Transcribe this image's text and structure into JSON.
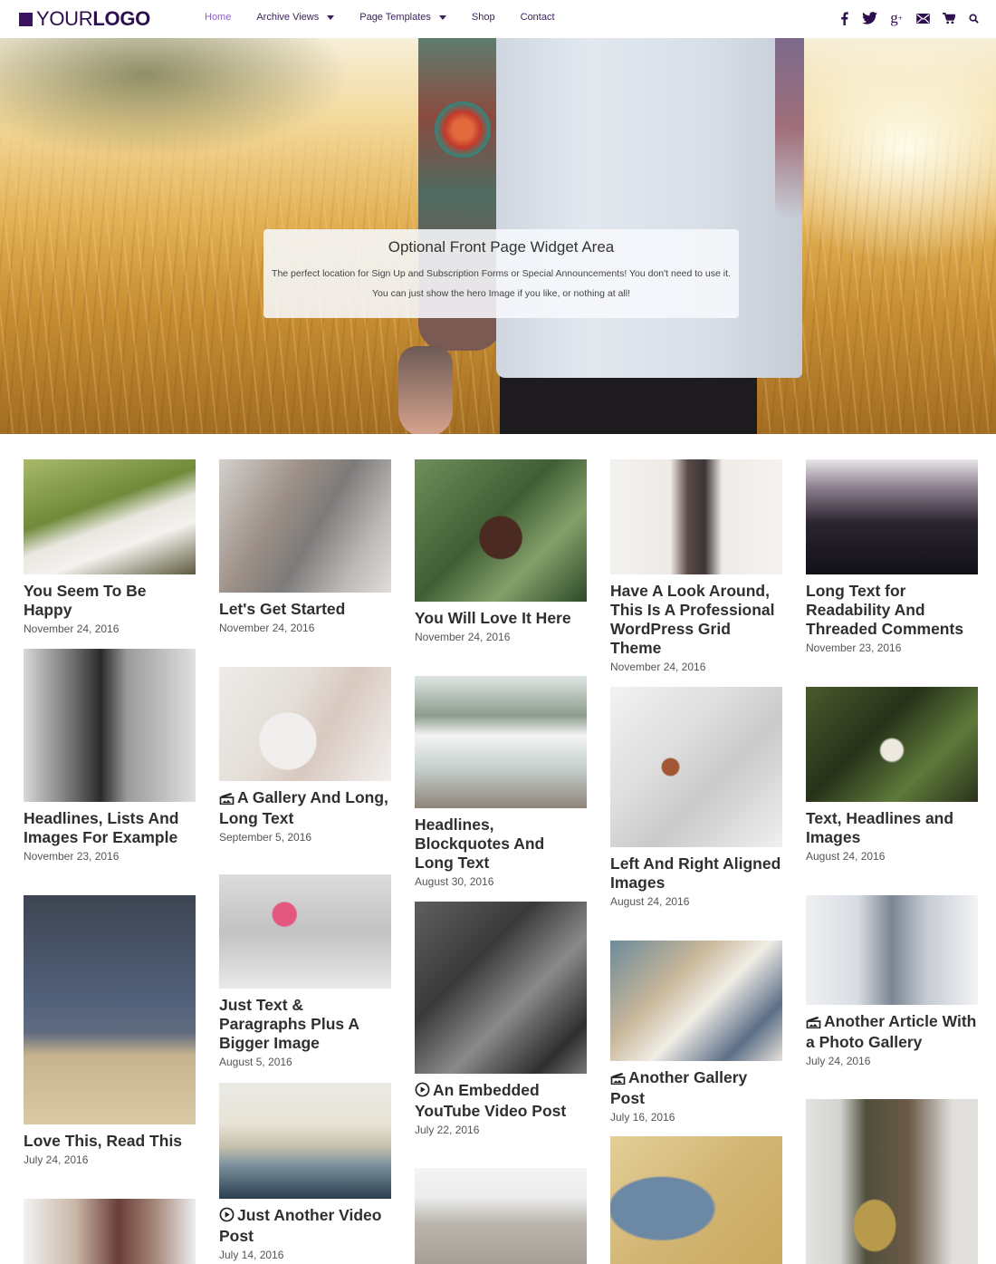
{
  "header": {
    "logo": {
      "light": "YOUR",
      "bold": "LOGO"
    },
    "nav": [
      {
        "label": "Home",
        "active": true,
        "dropdown": false
      },
      {
        "label": "Archive Views",
        "active": false,
        "dropdown": true
      },
      {
        "label": "Page Templates",
        "active": false,
        "dropdown": true
      },
      {
        "label": "Shop",
        "active": false,
        "dropdown": false
      },
      {
        "label": "Contact",
        "active": false,
        "dropdown": false
      }
    ],
    "social_icons": [
      "facebook-icon",
      "twitter-icon",
      "google-plus-icon",
      "email-icon",
      "cart-icon",
      "search-icon"
    ]
  },
  "hero": {
    "widget_title": "Optional Front Page Widget Area",
    "widget_text": "The perfect location for Sign Up and Subscription Forms or Special Announcements! You don't need to use it. You can just show the hero Image if you like, or nothing at all!"
  },
  "colors": {
    "brand": "#2d0f4f",
    "nav_active": "#8b5fc7",
    "text": "#2f2f2f"
  },
  "posts": [
    {
      "title": "You Seem To Be Happy",
      "date": "November 24, 2016",
      "format": ""
    },
    {
      "title": "Let's Get Started",
      "date": "November 24, 2016",
      "format": ""
    },
    {
      "title": "You Will Love It Here",
      "date": "November 24, 2016",
      "format": ""
    },
    {
      "title": "Have A Look Around, This Is A Professional WordPress Grid Theme",
      "date": "November 24, 2016",
      "format": ""
    },
    {
      "title": "Long Text for Readability And Threaded Comments",
      "date": "November 23, 2016",
      "format": ""
    },
    {
      "title": "Headlines, Lists And Images For Example",
      "date": "November 23, 2016",
      "format": ""
    },
    {
      "title": "A Gallery And Long, Long Text",
      "date": "September 5, 2016",
      "format": "gallery"
    },
    {
      "title": "Headlines, Blockquotes And Long Text",
      "date": "August 30, 2016",
      "format": ""
    },
    {
      "title": "Left And Right Aligned Images",
      "date": "August 24, 2016",
      "format": ""
    },
    {
      "title": "Text, Headlines and Images",
      "date": "August 24, 2016",
      "format": ""
    },
    {
      "title": "Love This, Read This",
      "date": "July 24, 2016",
      "format": ""
    },
    {
      "title": "Just Text & Paragraphs Plus A Bigger Image",
      "date": "August 5, 2016",
      "format": ""
    },
    {
      "title": "An Embedded YouTube Video Post",
      "date": "July 22, 2016",
      "format": "video"
    },
    {
      "title": "Another Gallery Post",
      "date": "July 16, 2016",
      "format": "gallery"
    },
    {
      "title": "Another Article With a Photo Gallery",
      "date": "July 24, 2016",
      "format": "gallery"
    },
    {
      "title": "Just Another Video Post",
      "date": "July 14, 2016",
      "format": "video"
    },
    {
      "title": "",
      "date": "",
      "format": ""
    },
    {
      "title": "",
      "date": "",
      "format": ""
    },
    {
      "title": "",
      "date": "",
      "format": ""
    },
    {
      "title": "",
      "date": "",
      "format": ""
    }
  ]
}
